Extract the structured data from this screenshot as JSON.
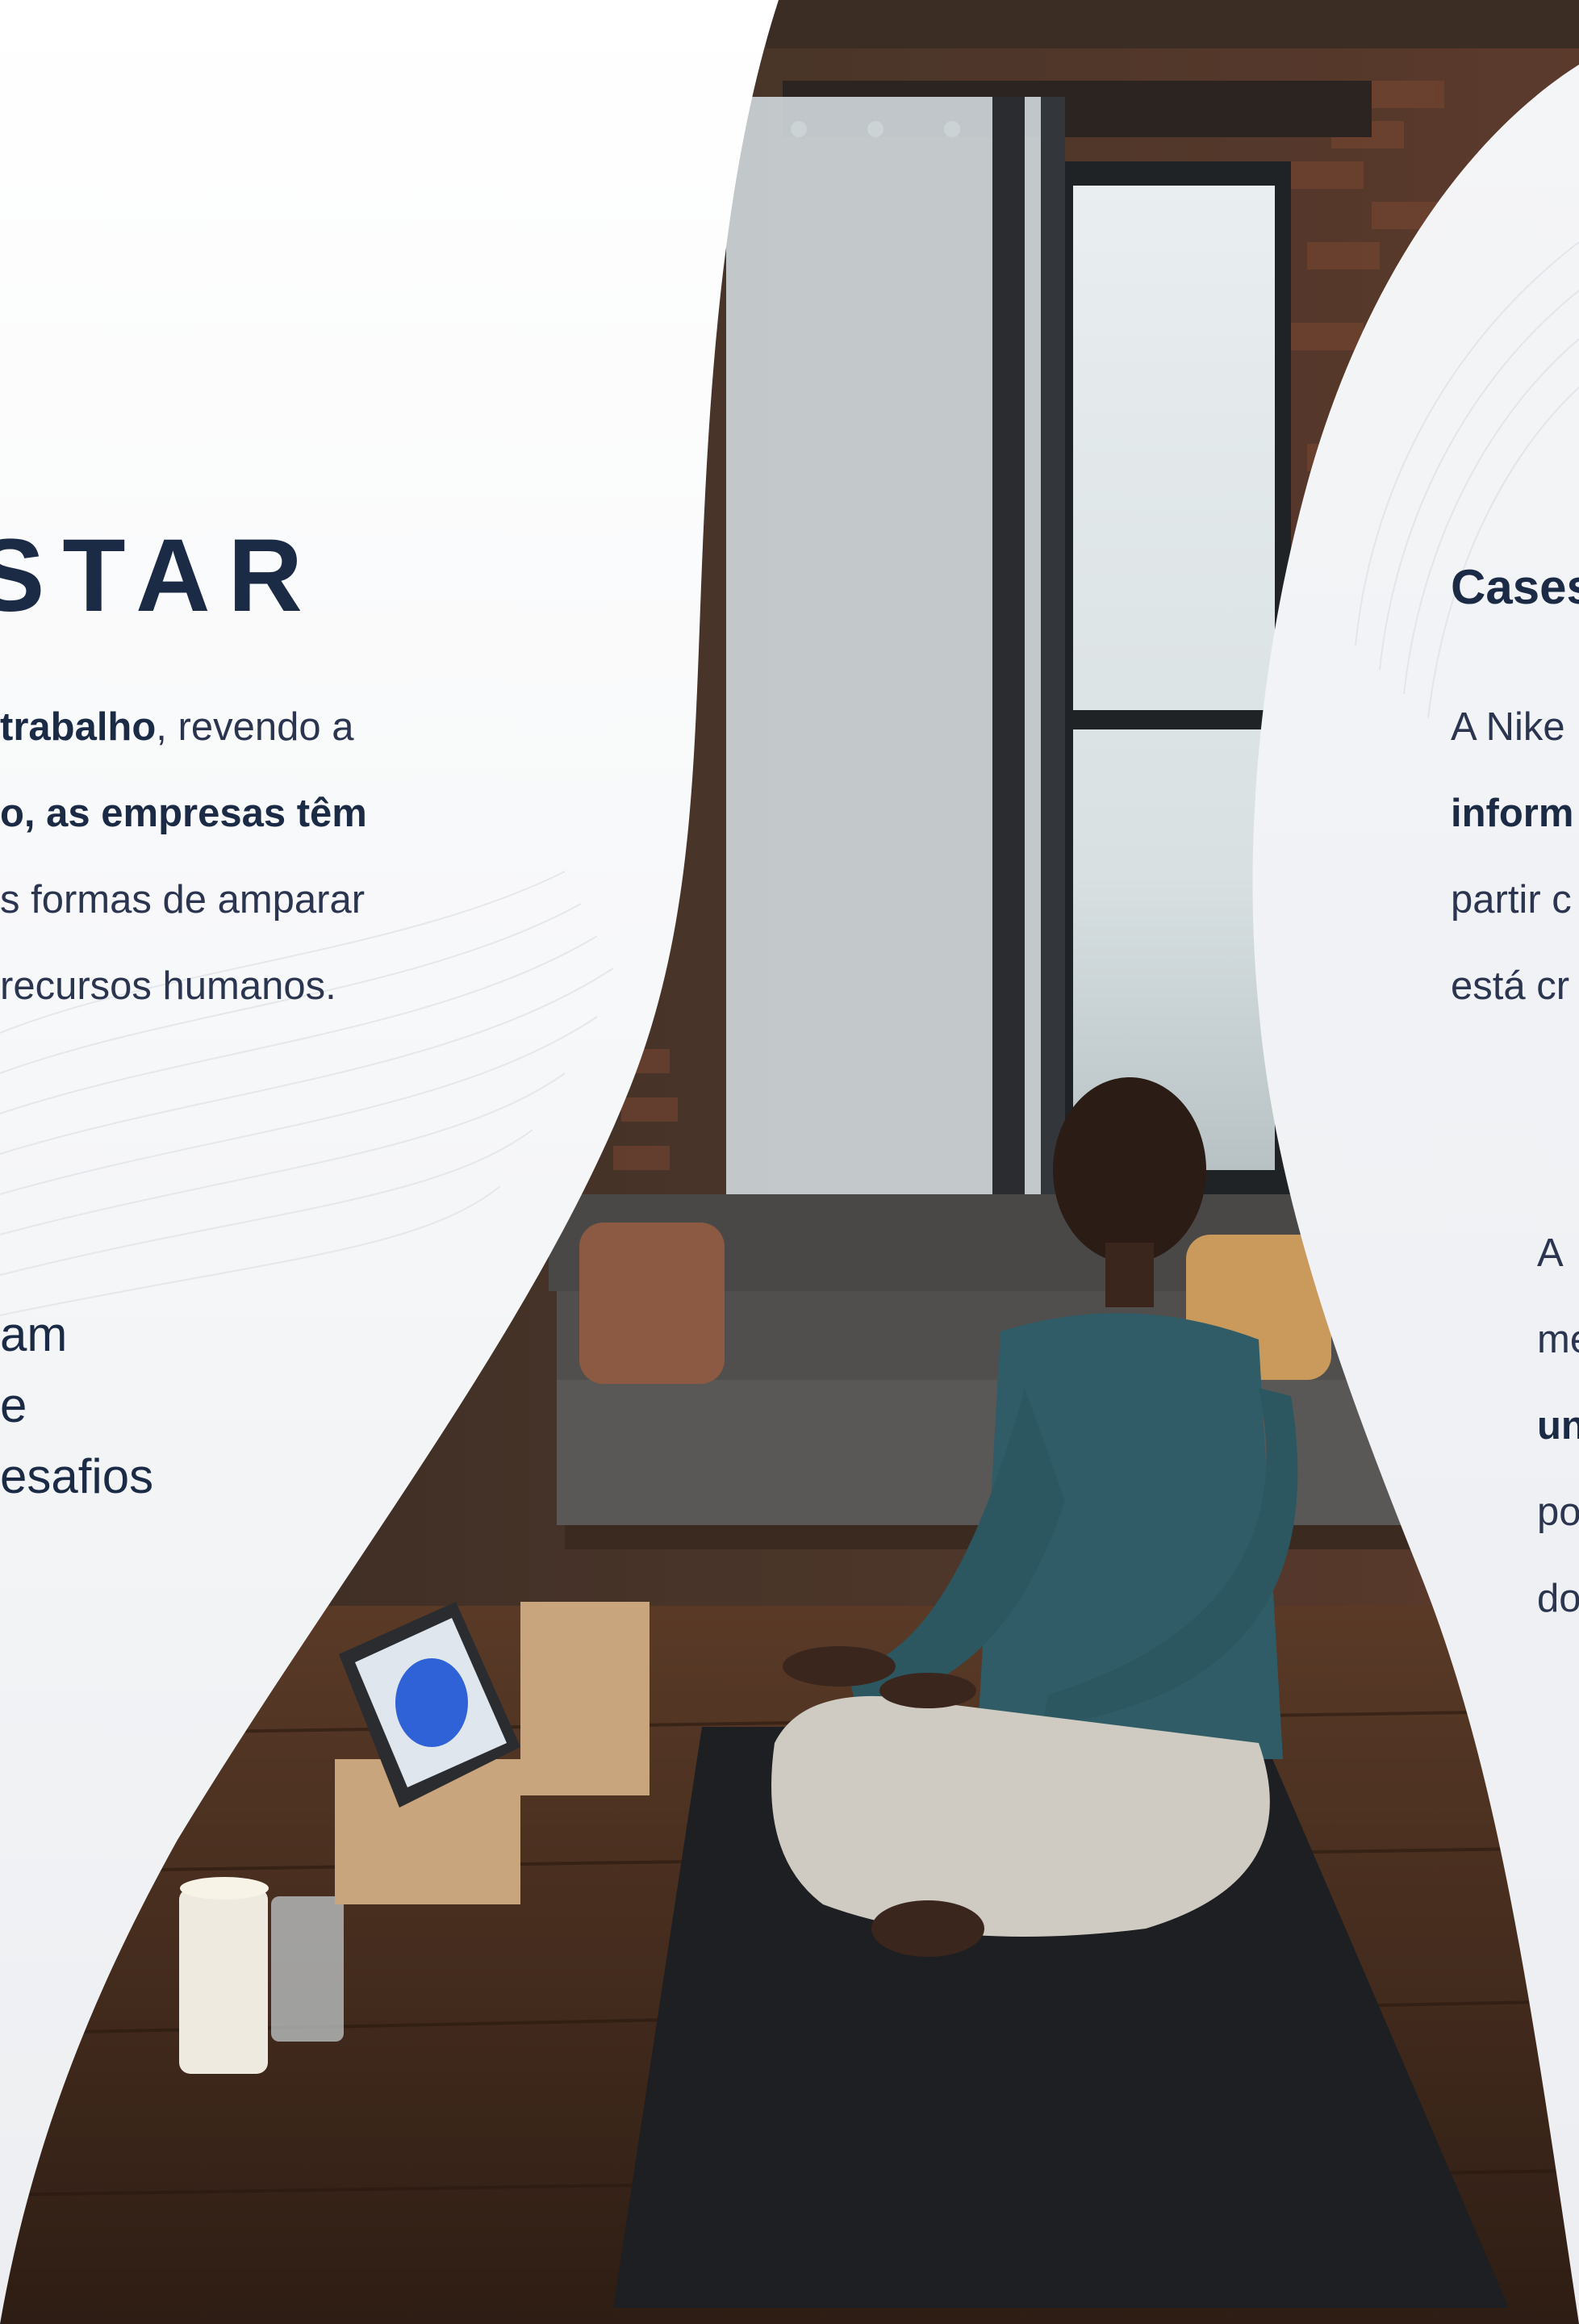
{
  "left_panel": {
    "title": "STAR",
    "paragraph_lines": [
      {
        "bold": "trabalho",
        "rest": ", revendo a"
      },
      {
        "bold": "o, as empresas têm",
        "rest": ""
      },
      {
        "bold": "",
        "rest": "s formas de amparar"
      },
      {
        "bold": "",
        "rest": " recursos humanos."
      }
    ],
    "highlight_lines": [
      "am",
      "e",
      "esafios"
    ]
  },
  "right_panel": {
    "heading": "Cases",
    "paragraph_lines": [
      {
        "bold": "",
        "rest": "A  Nike"
      },
      {
        "bold": "inform",
        "rest": ""
      },
      {
        "bold": "",
        "rest": "partir c"
      },
      {
        "bold": "",
        "rest": "está cr"
      }
    ],
    "paragraph2_lines": [
      {
        "bold": "",
        "rest": "A"
      },
      {
        "bold": "",
        "rest": "me"
      },
      {
        "bold": "un",
        "rest": ""
      },
      {
        "bold": "",
        "rest": "po"
      },
      {
        "bold": "",
        "rest": "do"
      }
    ]
  },
  "photo": {
    "subject": "person-meditating-icon"
  },
  "colors": {
    "navy": "#1b2a45",
    "panel_left": "#ffffff",
    "panel_right": "#f1f2f5"
  }
}
